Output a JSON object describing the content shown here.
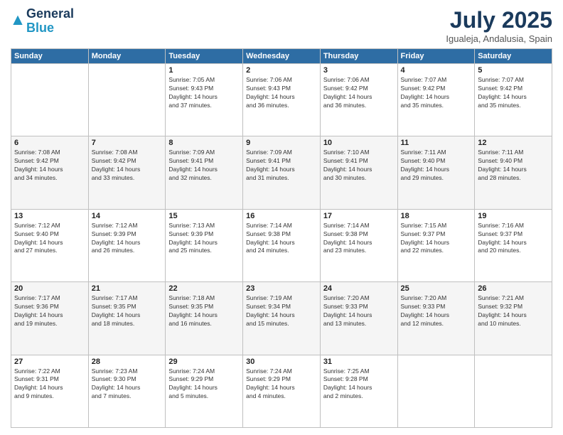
{
  "header": {
    "logo_line1": "General",
    "logo_line2": "Blue",
    "month": "July 2025",
    "location": "Igualeja, Andalusia, Spain"
  },
  "weekdays": [
    "Sunday",
    "Monday",
    "Tuesday",
    "Wednesday",
    "Thursday",
    "Friday",
    "Saturday"
  ],
  "weeks": [
    [
      {
        "day": "",
        "info": ""
      },
      {
        "day": "",
        "info": ""
      },
      {
        "day": "1",
        "info": "Sunrise: 7:05 AM\nSunset: 9:43 PM\nDaylight: 14 hours\nand 37 minutes."
      },
      {
        "day": "2",
        "info": "Sunrise: 7:06 AM\nSunset: 9:43 PM\nDaylight: 14 hours\nand 36 minutes."
      },
      {
        "day": "3",
        "info": "Sunrise: 7:06 AM\nSunset: 9:42 PM\nDaylight: 14 hours\nand 36 minutes."
      },
      {
        "day": "4",
        "info": "Sunrise: 7:07 AM\nSunset: 9:42 PM\nDaylight: 14 hours\nand 35 minutes."
      },
      {
        "day": "5",
        "info": "Sunrise: 7:07 AM\nSunset: 9:42 PM\nDaylight: 14 hours\nand 35 minutes."
      }
    ],
    [
      {
        "day": "6",
        "info": "Sunrise: 7:08 AM\nSunset: 9:42 PM\nDaylight: 14 hours\nand 34 minutes."
      },
      {
        "day": "7",
        "info": "Sunrise: 7:08 AM\nSunset: 9:42 PM\nDaylight: 14 hours\nand 33 minutes."
      },
      {
        "day": "8",
        "info": "Sunrise: 7:09 AM\nSunset: 9:41 PM\nDaylight: 14 hours\nand 32 minutes."
      },
      {
        "day": "9",
        "info": "Sunrise: 7:09 AM\nSunset: 9:41 PM\nDaylight: 14 hours\nand 31 minutes."
      },
      {
        "day": "10",
        "info": "Sunrise: 7:10 AM\nSunset: 9:41 PM\nDaylight: 14 hours\nand 30 minutes."
      },
      {
        "day": "11",
        "info": "Sunrise: 7:11 AM\nSunset: 9:40 PM\nDaylight: 14 hours\nand 29 minutes."
      },
      {
        "day": "12",
        "info": "Sunrise: 7:11 AM\nSunset: 9:40 PM\nDaylight: 14 hours\nand 28 minutes."
      }
    ],
    [
      {
        "day": "13",
        "info": "Sunrise: 7:12 AM\nSunset: 9:40 PM\nDaylight: 14 hours\nand 27 minutes."
      },
      {
        "day": "14",
        "info": "Sunrise: 7:12 AM\nSunset: 9:39 PM\nDaylight: 14 hours\nand 26 minutes."
      },
      {
        "day": "15",
        "info": "Sunrise: 7:13 AM\nSunset: 9:39 PM\nDaylight: 14 hours\nand 25 minutes."
      },
      {
        "day": "16",
        "info": "Sunrise: 7:14 AM\nSunset: 9:38 PM\nDaylight: 14 hours\nand 24 minutes."
      },
      {
        "day": "17",
        "info": "Sunrise: 7:14 AM\nSunset: 9:38 PM\nDaylight: 14 hours\nand 23 minutes."
      },
      {
        "day": "18",
        "info": "Sunrise: 7:15 AM\nSunset: 9:37 PM\nDaylight: 14 hours\nand 22 minutes."
      },
      {
        "day": "19",
        "info": "Sunrise: 7:16 AM\nSunset: 9:37 PM\nDaylight: 14 hours\nand 20 minutes."
      }
    ],
    [
      {
        "day": "20",
        "info": "Sunrise: 7:17 AM\nSunset: 9:36 PM\nDaylight: 14 hours\nand 19 minutes."
      },
      {
        "day": "21",
        "info": "Sunrise: 7:17 AM\nSunset: 9:35 PM\nDaylight: 14 hours\nand 18 minutes."
      },
      {
        "day": "22",
        "info": "Sunrise: 7:18 AM\nSunset: 9:35 PM\nDaylight: 14 hours\nand 16 minutes."
      },
      {
        "day": "23",
        "info": "Sunrise: 7:19 AM\nSunset: 9:34 PM\nDaylight: 14 hours\nand 15 minutes."
      },
      {
        "day": "24",
        "info": "Sunrise: 7:20 AM\nSunset: 9:33 PM\nDaylight: 14 hours\nand 13 minutes."
      },
      {
        "day": "25",
        "info": "Sunrise: 7:20 AM\nSunset: 9:33 PM\nDaylight: 14 hours\nand 12 minutes."
      },
      {
        "day": "26",
        "info": "Sunrise: 7:21 AM\nSunset: 9:32 PM\nDaylight: 14 hours\nand 10 minutes."
      }
    ],
    [
      {
        "day": "27",
        "info": "Sunrise: 7:22 AM\nSunset: 9:31 PM\nDaylight: 14 hours\nand 9 minutes."
      },
      {
        "day": "28",
        "info": "Sunrise: 7:23 AM\nSunset: 9:30 PM\nDaylight: 14 hours\nand 7 minutes."
      },
      {
        "day": "29",
        "info": "Sunrise: 7:24 AM\nSunset: 9:29 PM\nDaylight: 14 hours\nand 5 minutes."
      },
      {
        "day": "30",
        "info": "Sunrise: 7:24 AM\nSunset: 9:29 PM\nDaylight: 14 hours\nand 4 minutes."
      },
      {
        "day": "31",
        "info": "Sunrise: 7:25 AM\nSunset: 9:28 PM\nDaylight: 14 hours\nand 2 minutes."
      },
      {
        "day": "",
        "info": ""
      },
      {
        "day": "",
        "info": ""
      }
    ]
  ]
}
